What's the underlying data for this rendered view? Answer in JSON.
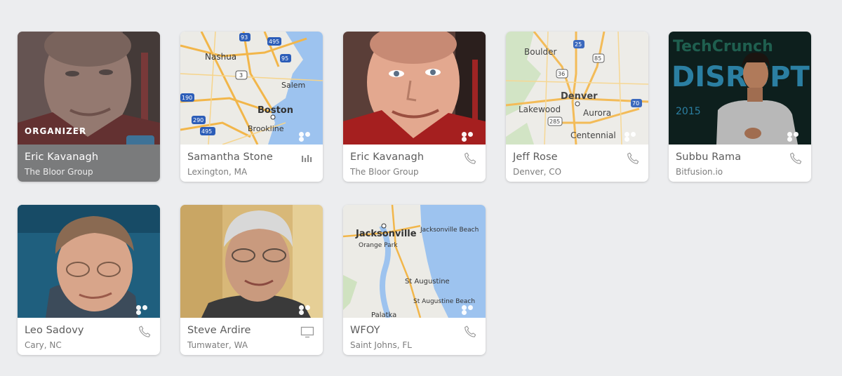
{
  "participants": [
    {
      "name": "Eric Kavanagh",
      "subtitle": "The Bloor Group",
      "badge": "ORGANIZER",
      "thumb": "photo",
      "action_icon": "none"
    },
    {
      "name": "Samantha Stone",
      "subtitle": "Lexington, MA",
      "thumb": "map",
      "map_labels": [
        "Nashua",
        "Salem",
        "Boston",
        "Brookline"
      ],
      "action_icon": "audio-bars-icon"
    },
    {
      "name": "Eric Kavanagh",
      "subtitle": "The Bloor Group",
      "thumb": "photo",
      "action_icon": "phone-icon"
    },
    {
      "name": "Jeff Rose",
      "subtitle": "Denver, CO",
      "thumb": "map",
      "map_labels": [
        "Boulder",
        "Denver",
        "Lakewood",
        "Aurora",
        "Centennial"
      ],
      "action_icon": "phone-icon"
    },
    {
      "name": "Subbu Rama",
      "subtitle": "Bitfusion.io",
      "thumb": "photo",
      "action_icon": "phone-icon"
    },
    {
      "name": "Leo Sadovy",
      "subtitle": "Cary, NC",
      "thumb": "photo",
      "action_icon": "phone-icon"
    },
    {
      "name": "Steve Ardire",
      "subtitle": "Tumwater, WA",
      "thumb": "photo",
      "action_icon": "monitor-icon"
    },
    {
      "name": "WFOY",
      "subtitle": "Saint Johns, FL",
      "thumb": "map",
      "map_labels": [
        "Jacksonville",
        "Jacksonville Beach",
        "Orange Park",
        "St Augustine",
        "St Augustine Beach",
        "Palatka"
      ],
      "action_icon": "phone-icon"
    }
  ],
  "stage_text": {
    "brand": "TechCrunch",
    "event": "DISRUPT",
    "year": "2015"
  },
  "map_shields": {
    "boston": [
      "93",
      "495",
      "95",
      "3",
      "190",
      "290",
      "495"
    ],
    "denver": [
      "25",
      "85",
      "36",
      "70",
      "285"
    ]
  },
  "colors": {
    "background": "#ecedef",
    "organizer_bar": "#7a7b7c",
    "water": "#9dc3ef",
    "land": "#ecebe6"
  }
}
